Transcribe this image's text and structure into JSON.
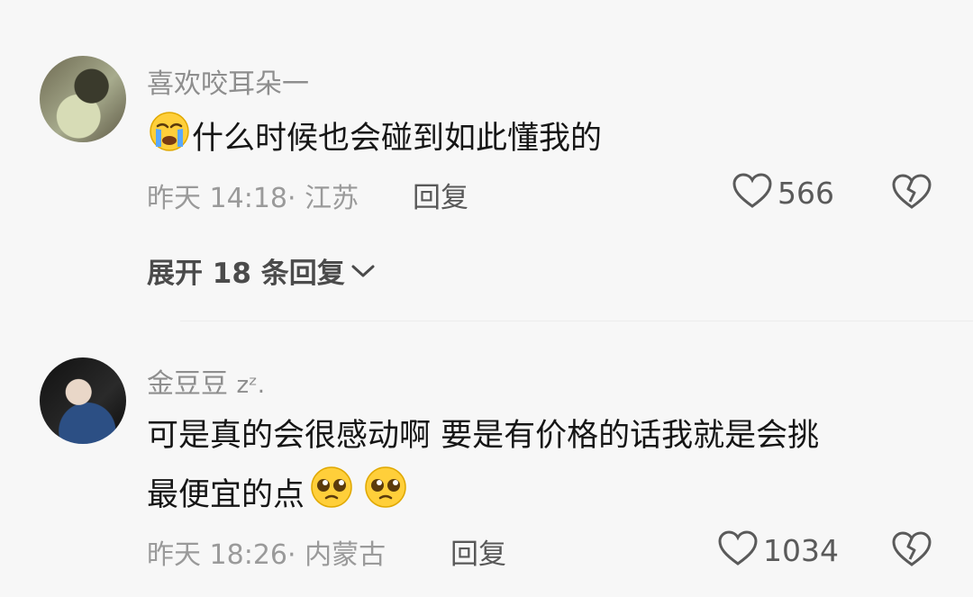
{
  "comments": [
    {
      "username": "喜欢咬耳朵一",
      "emoji_lead": "loudly-crying-face",
      "text": "什么时候也会碰到如此懂我的",
      "meta": "昨天 14:18· 江苏",
      "reply_label": "回复",
      "likes": "566",
      "expand_label": "展开 18 条回复"
    },
    {
      "username": "金豆豆",
      "username_suffix": "zᶻ.",
      "text_line1": "可是真的会很感动啊  要是有价格的话我就是会挑",
      "text_line2": "最便宜的点",
      "emoji_trail": "pleading-face",
      "meta": "昨天 18:26· 内蒙古",
      "reply_label": "回复",
      "likes": "1034"
    }
  ],
  "colors": {
    "background": "#f7f7f7",
    "username": "#8e8e8e",
    "text": "#161616",
    "meta": "#9a9a9a"
  }
}
